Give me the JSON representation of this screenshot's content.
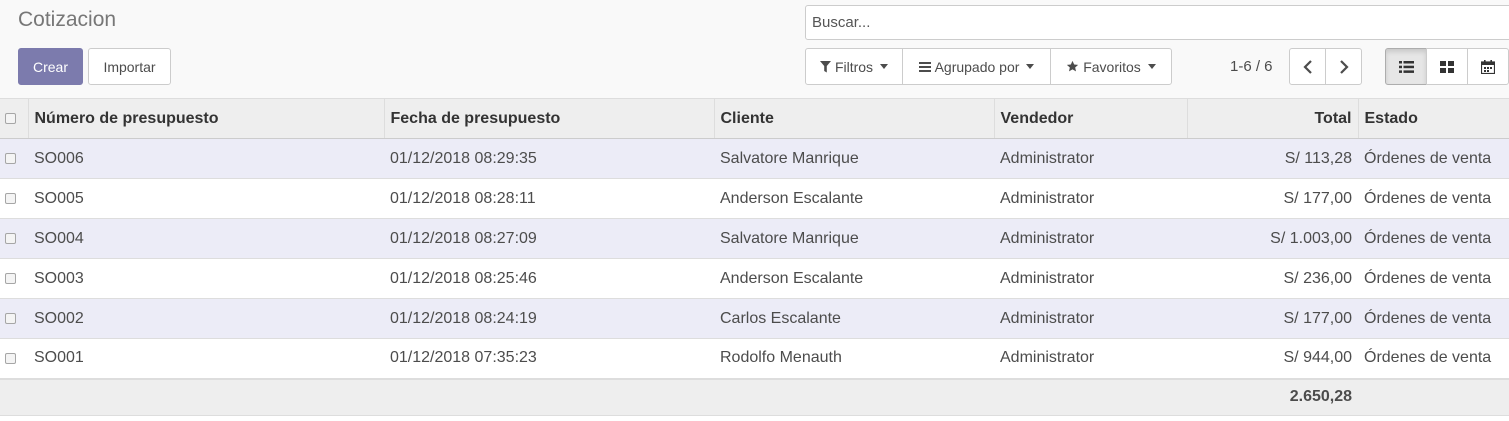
{
  "header": {
    "title": "Cotizacion",
    "create_label": "Crear",
    "import_label": "Importar"
  },
  "search": {
    "placeholder": "Buscar..."
  },
  "filters": {
    "filters_label": "Filtros",
    "group_by_label": "Agrupado por",
    "favorites_label": "Favoritos"
  },
  "pager": {
    "value": "1-6 / 6"
  },
  "views": {
    "active": "list",
    "items": [
      "list-view-icon",
      "kanban-view-icon",
      "calendar-view-icon"
    ]
  },
  "table": {
    "columns": [
      "Número de presupuesto",
      "Fecha de presupuesto",
      "Cliente",
      "Vendedor",
      "Total",
      "Estado"
    ],
    "rows": [
      [
        "SO006",
        "01/12/2018 08:29:35",
        "Salvatore Manrique",
        "Administrator",
        "S/ 113,28",
        "Órdenes de venta"
      ],
      [
        "SO005",
        "01/12/2018 08:28:11",
        "Anderson Escalante",
        "Administrator",
        "S/ 177,00",
        "Órdenes de venta"
      ],
      [
        "SO004",
        "01/12/2018 08:27:09",
        "Salvatore Manrique",
        "Administrator",
        "S/ 1.003,00",
        "Órdenes de venta"
      ],
      [
        "SO003",
        "01/12/2018 08:25:46",
        "Anderson Escalante",
        "Administrator",
        "S/ 236,00",
        "Órdenes de venta"
      ],
      [
        "SO002",
        "01/12/2018 08:24:19",
        "Carlos Escalante",
        "Administrator",
        "S/ 177,00",
        "Órdenes de venta"
      ],
      [
        "SO001",
        "01/12/2018 07:35:23",
        "Rodolfo Menauth",
        "Administrator",
        "S/ 944,00",
        "Órdenes de venta"
      ]
    ],
    "total": "2.650,28"
  },
  "colors": {
    "primary": "#7c7bad",
    "row_alt": "#ececf7",
    "header_bg": "#eeeeee"
  }
}
